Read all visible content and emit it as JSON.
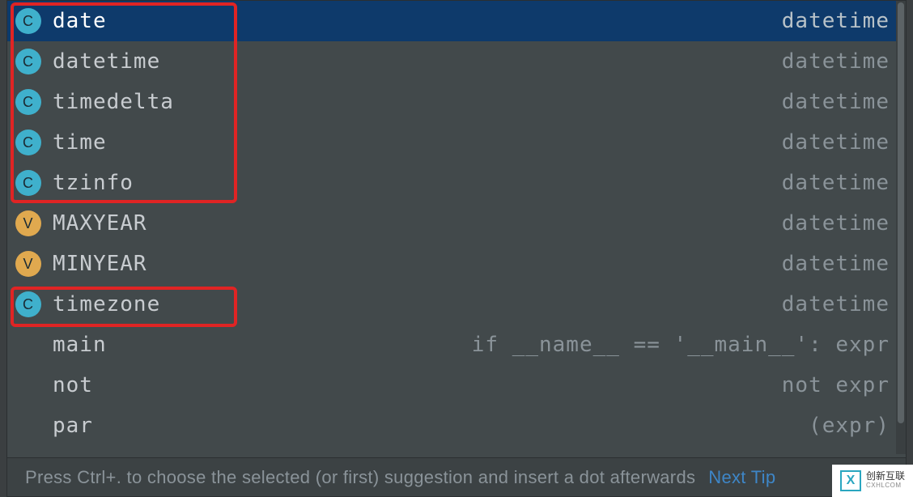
{
  "completion": {
    "items": [
      {
        "kind": "class",
        "kindGlyph": "C",
        "name": "date",
        "hint": "datetime",
        "selected": true,
        "highlighted": true
      },
      {
        "kind": "class",
        "kindGlyph": "C",
        "name": "datetime",
        "hint": "datetime",
        "selected": false,
        "highlighted": true
      },
      {
        "kind": "class",
        "kindGlyph": "C",
        "name": "timedelta",
        "hint": "datetime",
        "selected": false,
        "highlighted": true
      },
      {
        "kind": "class",
        "kindGlyph": "C",
        "name": "time",
        "hint": "datetime",
        "selected": false,
        "highlighted": true
      },
      {
        "kind": "class",
        "kindGlyph": "C",
        "name": "tzinfo",
        "hint": "datetime",
        "selected": false,
        "highlighted": true
      },
      {
        "kind": "variable",
        "kindGlyph": "V",
        "name": "MAXYEAR",
        "hint": "datetime",
        "selected": false,
        "highlighted": false
      },
      {
        "kind": "variable",
        "kindGlyph": "V",
        "name": "MINYEAR",
        "hint": "datetime",
        "selected": false,
        "highlighted": false
      },
      {
        "kind": "class",
        "kindGlyph": "C",
        "name": "timezone",
        "hint": "datetime",
        "selected": false,
        "highlighted": true
      },
      {
        "kind": "keyword",
        "kindGlyph": "",
        "name": "main",
        "hint": "if __name__ == '__main__': expr",
        "selected": false,
        "highlighted": false
      },
      {
        "kind": "keyword",
        "kindGlyph": "",
        "name": "not",
        "hint": "not expr",
        "selected": false,
        "highlighted": false
      },
      {
        "kind": "keyword",
        "kindGlyph": "",
        "name": "par",
        "hint": "(expr)",
        "selected": false,
        "highlighted": false
      }
    ]
  },
  "status": {
    "tip": "Press Ctrl+. to choose the selected (or first) suggestion and insert a dot afterwards",
    "next_tip": "Next Tip"
  },
  "watermark": {
    "brand": "创新互联",
    "sub": "CXHLCOM"
  },
  "colors": {
    "bg": "#42494b",
    "selected": "#0e3a6b",
    "classIcon": "#3fb0cc",
    "varIcon": "#e0a94f",
    "annotation": "#e02424",
    "link": "#3e86c7"
  }
}
